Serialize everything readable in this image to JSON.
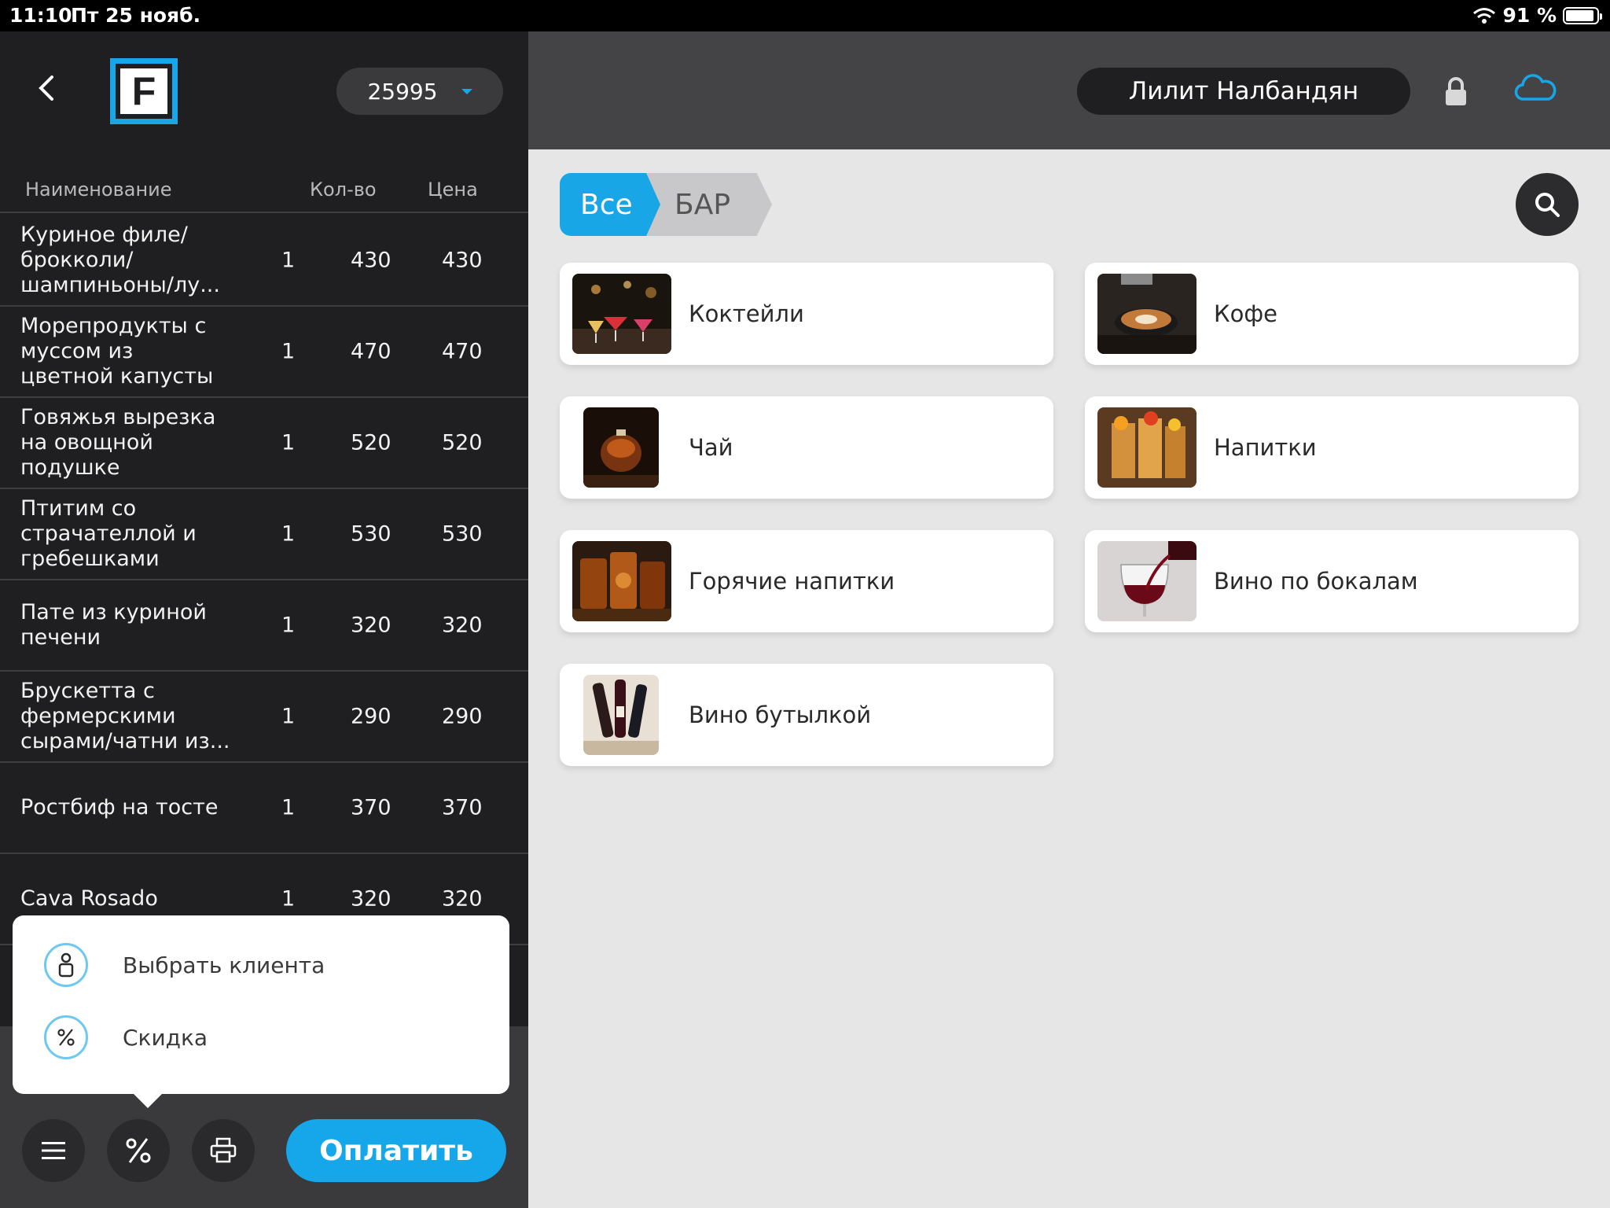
{
  "status_bar": {
    "time": "11:10",
    "date": "Пт 25 нояб.",
    "battery": "91 %",
    "battery_level": 0.91
  },
  "order": {
    "number": "25995"
  },
  "table": {
    "headers": {
      "name": "Наименование",
      "qty": "Кол-во",
      "price": "Цена"
    },
    "rows": [
      {
        "name": "Куриное филе/ брокколи/ шампиньоны/лу...",
        "qty": "1",
        "price": "430",
        "sum": "430"
      },
      {
        "name": "Морепродукты с муссом из цветной капусты",
        "qty": "1",
        "price": "470",
        "sum": "470"
      },
      {
        "name": "Говяжья вырезка на овощной подушке",
        "qty": "1",
        "price": "520",
        "sum": "520"
      },
      {
        "name": "Птитим со страчателлой и гребешками",
        "qty": "1",
        "price": "530",
        "sum": "530"
      },
      {
        "name": "Пате из куриной печени",
        "qty": "1",
        "price": "320",
        "sum": "320"
      },
      {
        "name": "Брускетта с фермерскими сырами/чатни из...",
        "qty": "1",
        "price": "290",
        "sum": "290"
      },
      {
        "name": "Ростбиф на тосте",
        "qty": "1",
        "price": "370",
        "sum": "370"
      },
      {
        "name": "Cava Rosado",
        "qty": "1",
        "price": "320",
        "sum": "320"
      }
    ]
  },
  "popup": {
    "items": [
      {
        "label": "Выбрать клиента",
        "icon": "user-icon"
      },
      {
        "label": "Скидка",
        "icon": "percent-icon"
      }
    ]
  },
  "footer": {
    "pay_label": "Оплатить"
  },
  "header": {
    "user_name": "Лилит Налбандян"
  },
  "breadcrumbs": [
    "Все",
    "БАР"
  ],
  "categories": [
    {
      "label": "Коктейли"
    },
    {
      "label": "Кофе"
    },
    {
      "label": "Чай"
    },
    {
      "label": "Напитки"
    },
    {
      "label": "Горячие напитки"
    },
    {
      "label": "Вино по бокалам"
    },
    {
      "label": "Вино бутылкой"
    }
  ],
  "colors": {
    "accent": "#18a6e6",
    "panel_dark": "#1f1f21",
    "topbar": "#444446",
    "content_bg": "#e6e6e7"
  }
}
